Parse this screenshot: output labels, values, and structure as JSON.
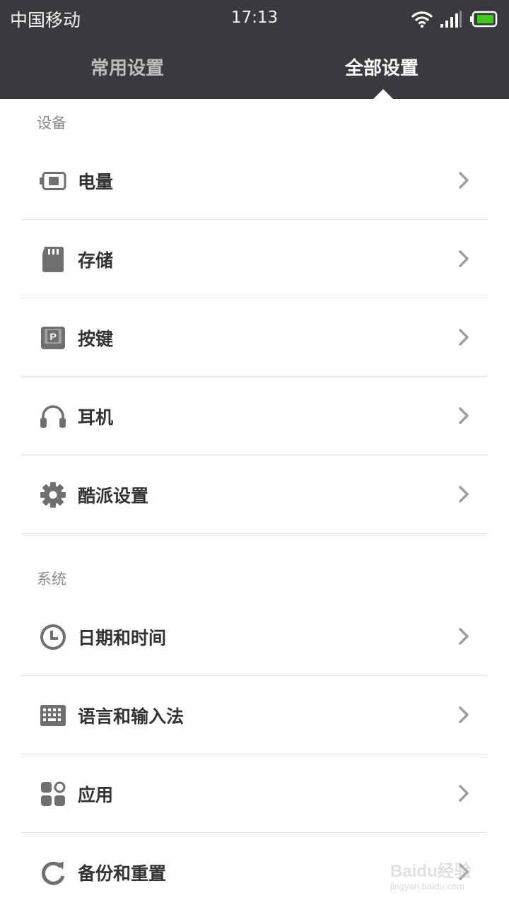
{
  "status_bar": {
    "carrier": "中国移动",
    "time": "17:13",
    "icons": [
      "wifi-icon",
      "signal-icon",
      "battery-icon"
    ],
    "battery_color": "#41c71e"
  },
  "tabs": [
    {
      "label": "常用设置",
      "active": false
    },
    {
      "label": "全部设置",
      "active": true
    }
  ],
  "sections": [
    {
      "title": "设备",
      "items": [
        {
          "label": "电量",
          "icon": "battery-icon"
        },
        {
          "label": "存储",
          "icon": "sd-card-icon"
        },
        {
          "label": "按键",
          "icon": "key-icon"
        },
        {
          "label": "耳机",
          "icon": "headphones-icon"
        },
        {
          "label": "酷派设置",
          "icon": "gear-icon"
        }
      ]
    },
    {
      "title": "系统",
      "items": [
        {
          "label": "日期和时间",
          "icon": "clock-icon"
        },
        {
          "label": "语言和输入法",
          "icon": "keyboard-icon"
        },
        {
          "label": "应用",
          "icon": "apps-icon"
        },
        {
          "label": "备份和重置",
          "icon": "backup-icon"
        }
      ]
    }
  ],
  "watermark": {
    "main": "Baidu经验",
    "sub": "jingyan.baidu.com"
  },
  "colors": {
    "header_bg": "#3a3a3e",
    "icon_gray": "#6f6f6f",
    "chevron": "#9e9e9e"
  }
}
